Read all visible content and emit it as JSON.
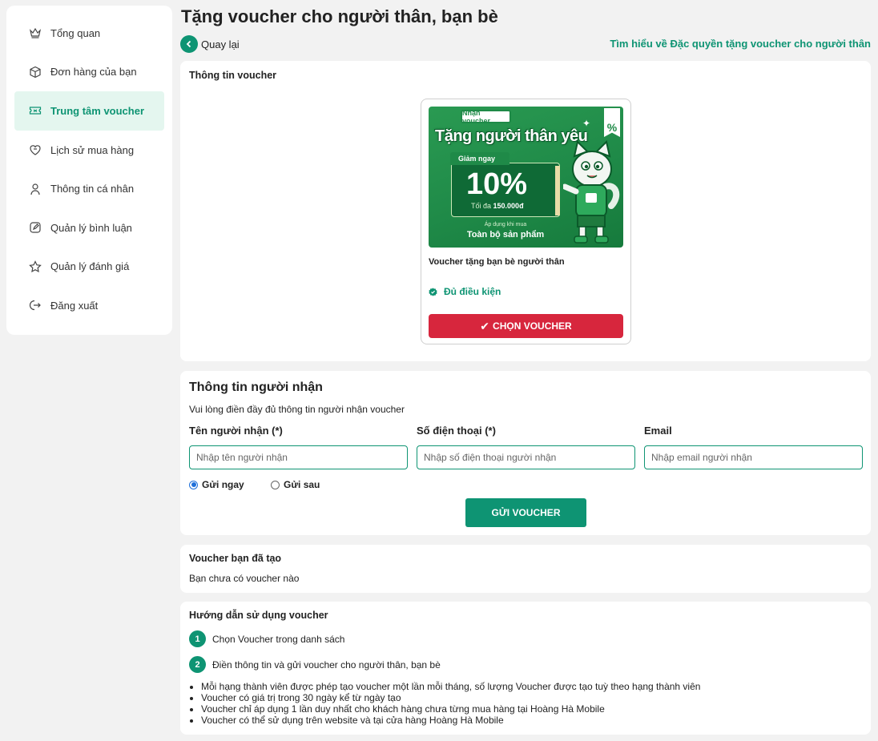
{
  "sidebar": {
    "items": [
      {
        "label": "Tổng quan",
        "icon": "crown-icon",
        "active": false
      },
      {
        "label": "Đơn hàng của bạn",
        "icon": "box-icon",
        "active": false
      },
      {
        "label": "Trung tâm voucher",
        "icon": "ticket-icon",
        "active": true
      },
      {
        "label": "Lịch sử mua hàng",
        "icon": "history-icon",
        "active": false
      },
      {
        "label": "Thông tin cá nhân",
        "icon": "user-icon",
        "active": false
      },
      {
        "label": "Quản lý bình luận",
        "icon": "comment-edit-icon",
        "active": false
      },
      {
        "label": "Quản lý đánh giá",
        "icon": "star-icon",
        "active": false
      },
      {
        "label": "Đăng xuất",
        "icon": "logout-icon",
        "active": false
      }
    ]
  },
  "header": {
    "title": "Tặng voucher cho người thân, bạn bè",
    "back_label": "Quay lại",
    "learn_link": "Tìm hiểu về Đặc quyền tặng voucher cho người thân"
  },
  "voucher_info": {
    "title": "Thông tin voucher",
    "banner": {
      "tag": "Nhận voucher",
      "headline": "Tặng người thân yêu",
      "discount_label": "Giảm ngay",
      "discount": "10%",
      "max_prefix": "Tối đa",
      "max_value": "150.000đ",
      "applies_label": "Áp dụng khi mua",
      "applies_value": "Toàn bộ sản phẩm",
      "percent_badge": "%"
    },
    "name": "Voucher tặng bạn bè người thân",
    "status": "Đủ điều kiện",
    "select_label": "CHỌN VOUCHER"
  },
  "recipient": {
    "title": "Thông tin người nhận",
    "subtitle": "Vui lòng điền đầy đủ thông tin người nhận voucher",
    "name_label": "Tên người nhận (*)",
    "name_placeholder": "Nhập tên người nhận",
    "name_value": "",
    "phone_label": "Số điện thoại (*)",
    "phone_placeholder": "Nhập số điện thoại người nhận",
    "phone_value": "",
    "email_label": "Email",
    "email_placeholder": "Nhập email người nhận",
    "email_value": "",
    "send_now": "Gửi ngay",
    "send_later": "Gửi sau",
    "selected_option": "Gửi ngay",
    "submit_label": "GỬI VOUCHER"
  },
  "created": {
    "title": "Voucher bạn đã tạo",
    "empty": "Bạn chưa có voucher nào"
  },
  "guide": {
    "title": "Hướng dẫn sử dụng voucher",
    "steps": [
      {
        "num": "1",
        "text": "Chọn Voucher trong danh sách"
      },
      {
        "num": "2",
        "text": "Điền thông tin và gửi voucher cho người thân, bạn bè"
      }
    ],
    "notes": [
      "Mỗi hạng thành viên được phép tạo voucher một lần mỗi tháng, số lượng Voucher được tạo tuỳ theo hạng thành viên",
      "Voucher có giá trị trong 30 ngày kể từ ngày tạo",
      "Voucher chỉ áp dụng 1 lần duy nhất cho khách hàng chưa từng mua hàng tại Hoàng Hà Mobile",
      "Voucher có thể sử dụng trên website và tại cửa hàng Hoàng Hà Mobile"
    ]
  },
  "colors": {
    "accent": "#0e9473",
    "danger": "#d7263d",
    "active_bg": "#e4f6ef",
    "page_bg": "#f2f2f2"
  }
}
